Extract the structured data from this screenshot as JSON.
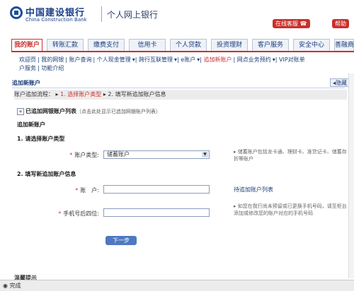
{
  "header": {
    "bank_cn": "中国建设银行",
    "bank_en": "China Construction Bank",
    "portal_title": "个人网上银行",
    "online_service": "在线客服",
    "help": "帮助"
  },
  "tabs": [
    {
      "label": "我的账户",
      "active": true
    },
    {
      "label": "转账汇款"
    },
    {
      "label": "缴费支付"
    },
    {
      "label": "信用卡"
    },
    {
      "label": "个人贷款"
    },
    {
      "label": "投资理财"
    },
    {
      "label": "客户服务"
    },
    {
      "label": "安全中心"
    },
    {
      "label": "善融商"
    }
  ],
  "subnav": {
    "items": [
      "欢迎页",
      "我的网银",
      "账户查询",
      "个人现金管理",
      "跨行互联管理",
      "e账户",
      "追加新账户",
      "网点业务预约",
      "VIP对账单",
      "户服务",
      "功能介绍"
    ]
  },
  "section": {
    "title": "追加新账户",
    "hide": "隐藏"
  },
  "steps": {
    "prefix": "账户追加流程：",
    "step1": "1. 选择账户类型",
    "step2": "2. 填写新追加账户信息"
  },
  "added_list": {
    "label": "已追加网银账户列表",
    "hint": "（点击此处显示已追加网银账户列表）"
  },
  "form": {
    "heading": "追加新账户",
    "step1_title": "1. 请选择账户类型",
    "type_label": "账户类型:",
    "type_value": "储蓄账户",
    "type_hint": "储蓄账户包括龙卡通、理财卡、准贷记卡、储蓄存折等账户",
    "step2_title": "2. 填写新追加账户信息",
    "account_label": "账　户:",
    "account_hint": "待追加账户列表",
    "phone_label": "手机号后四位:",
    "phone_hint": "如您在我行尚未预留或已更换手机号码，请至柜台添加或修改您的账户对应的手机号码",
    "next_button": "下一步"
  },
  "bottom": {
    "title": "温馨提示"
  },
  "status": {
    "text": "完成"
  }
}
